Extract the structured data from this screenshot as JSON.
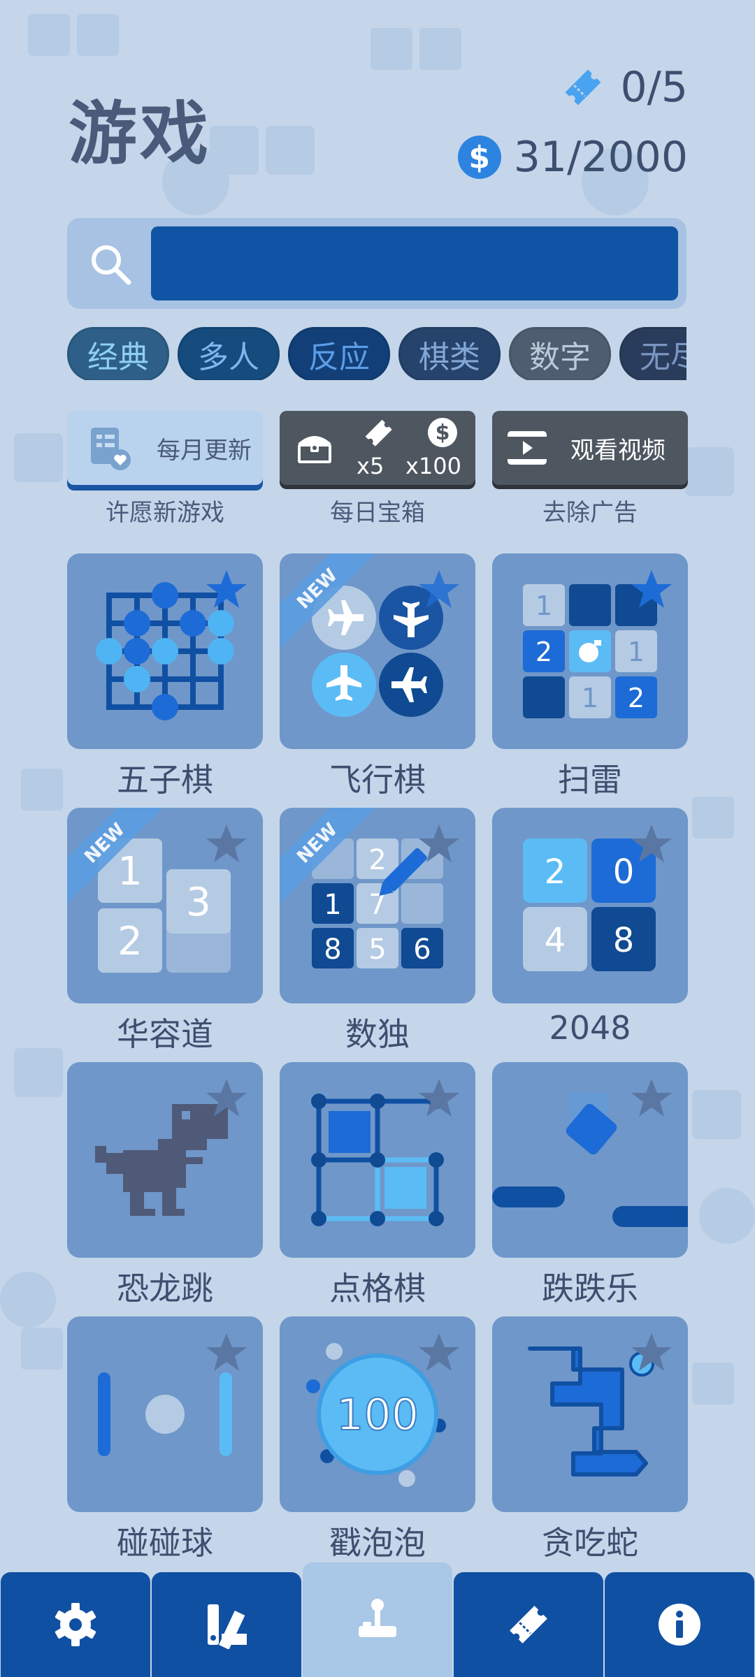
{
  "header": {
    "title": "游戏",
    "tickets_value": "0/5",
    "coins_value": "31/2000",
    "coin_symbol": "$"
  },
  "search": {
    "value": "",
    "placeholder": ""
  },
  "categories": [
    "经典",
    "多人",
    "反应",
    "棋类",
    "数字",
    "无尽"
  ],
  "actions": [
    {
      "button_text": "每月更新",
      "label": "许愿新游戏",
      "icon": "wish-list-icon"
    },
    {
      "reward_tickets": "x5",
      "reward_coins": "x100",
      "label": "每日宝箱",
      "icon": "treasure-chest-icon"
    },
    {
      "button_text": "观看视频",
      "label": "去除广告",
      "icon": "video-icon"
    }
  ],
  "games": [
    {
      "name": "五子棋",
      "new": false
    },
    {
      "name": "飞行棋",
      "new": true
    },
    {
      "name": "扫雷",
      "new": false
    },
    {
      "name": "华容道",
      "new": true
    },
    {
      "name": "数独",
      "new": true
    },
    {
      "name": "2048",
      "new": false
    },
    {
      "name": "恐龙跳",
      "new": false
    },
    {
      "name": "点格棋",
      "new": false
    },
    {
      "name": "跌跌乐",
      "new": false
    },
    {
      "name": "碰碰球",
      "new": false
    },
    {
      "name": "戳泡泡",
      "new": false
    },
    {
      "name": "贪吃蛇",
      "new": false
    }
  ],
  "ribbon_text": "NEW",
  "tile_text": {
    "minesweeper": [
      "1",
      "2",
      "1",
      "1",
      "2"
    ],
    "klotski": [
      "1",
      "3",
      "2"
    ],
    "sudoku": [
      "2",
      "1",
      "7",
      "8",
      "5",
      "6"
    ],
    "g2048": [
      "2",
      "0",
      "4",
      "8"
    ],
    "bubble": "100"
  },
  "nav": [
    {
      "icon": "gear-icon",
      "active": false
    },
    {
      "icon": "palette-icon",
      "active": false
    },
    {
      "icon": "joystick-icon",
      "active": true
    },
    {
      "icon": "ticket-icon",
      "active": false
    },
    {
      "icon": "info-icon",
      "active": false
    }
  ],
  "colors": {
    "background": "#c5d6ea",
    "primary": "#1050a3",
    "tile": "#6f97c9",
    "accent_blue": "#2d84e0",
    "light_blue": "#5bbcf5",
    "text": "#3d4f6f"
  }
}
